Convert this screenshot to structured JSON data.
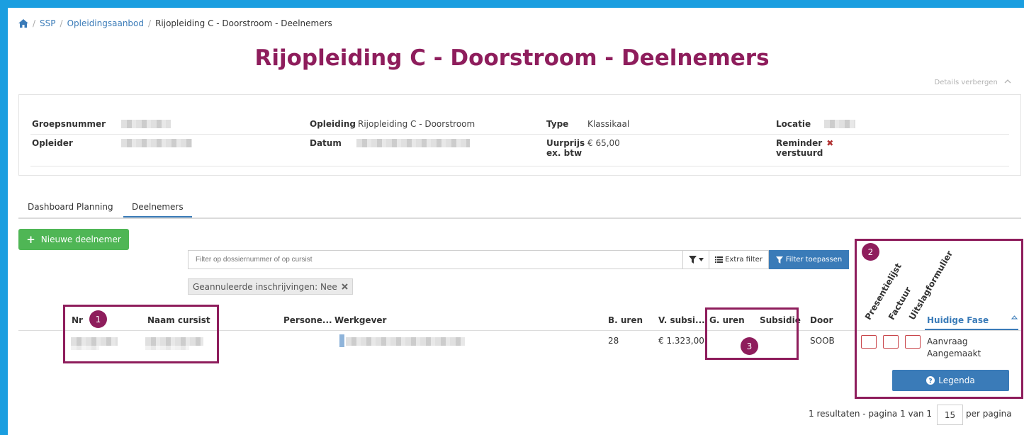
{
  "breadcrumb": {
    "home_icon": "home-icon",
    "items": [
      "SSP",
      "Opleidingsaanbod"
    ],
    "current": "Rijopleiding C - Doorstroom - Deelnemers"
  },
  "page": {
    "title": "Rijopleiding C - Doorstroom - Deelnemers"
  },
  "details": {
    "toggle_label": "Details verbergen",
    "groepsnummer_label": "Groepsnummer",
    "opleider_label": "Opleider",
    "opleiding_label": "Opleiding",
    "opleiding_value": "Rijopleiding C - Doorstroom",
    "datum_label": "Datum",
    "type_label": "Type",
    "type_value": "Klassikaal",
    "uurprijs_label_1": "Uurprijs",
    "uurprijs_label_2": "ex. btw",
    "uurprijs_value": "€ 65,00",
    "locatie_label": "Locatie",
    "reminder_label_1": "Reminder",
    "reminder_label_2": "verstuurd",
    "reminder_mark": "✖"
  },
  "tabs": [
    {
      "label": "Dashboard Planning",
      "active": false
    },
    {
      "label": "Deelnemers",
      "active": true
    }
  ],
  "actions": {
    "new_participant": "Nieuwe deelnemer"
  },
  "filter": {
    "placeholder": "Filter op dossiernummer of op cursist",
    "extra_filter": "Extra filter",
    "apply": "Filter toepassen",
    "chip": "Geannuleerde inschrijvingen: Nee"
  },
  "table": {
    "headers": {
      "nr": "Nr",
      "naam": "Naam cursist",
      "personeel": "Persone...",
      "werkgever": "Werkgever",
      "b_uren": "B. uren",
      "v_subsidie": "V. subsi...",
      "g_uren": "G. uren",
      "subsidie": "Subsidie",
      "door": "Door",
      "presentielijst": "Presentielijst",
      "factuur": "Factuur",
      "uitslagformulier": "Uitslagformulier",
      "huidige_fase": "Huidige Fase"
    },
    "rows": [
      {
        "b_uren": "28",
        "v_subsidie": "€ 1.323,00",
        "door": "SOOB",
        "fase_line1": "Aanvraag",
        "fase_line2": "Aangemaakt"
      }
    ]
  },
  "legend_button": "Legenda",
  "pagination": {
    "summary": "1 resultaten - pagina 1 van 1",
    "per_page_value": "15",
    "per_page_label": "per pagina"
  },
  "annotations": [
    "1",
    "2",
    "3"
  ],
  "colors": {
    "frame": "#1a9ee0",
    "title": "#8e1d5c",
    "primary": "#3a7bb8",
    "success": "#4fb655",
    "annotation": "#8e1d5c",
    "danger": "#b03030"
  }
}
